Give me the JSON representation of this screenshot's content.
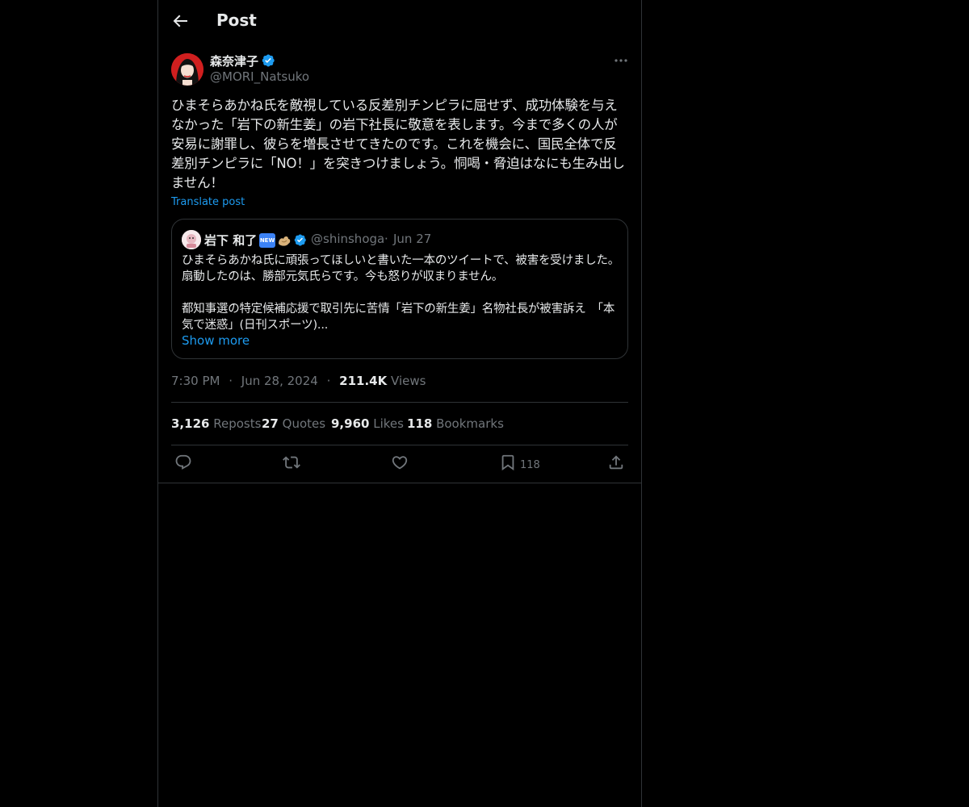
{
  "header": {
    "title": "Post"
  },
  "author": {
    "name": "森奈津子",
    "handle": "@MORI_Natsuko"
  },
  "post": {
    "text": "ひまそらあかね氏を敵視している反差別チンピラに屈せず、成功体験を与えなかった「岩下の新生姜」の岩下社長に敬意を表します。今まで多くの人が安易に謝罪し、彼らを増長させてきたのです。これを機会に、国民全体で反差別チンピラに「NO！」を突きつけましょう。恫喝・脅迫はなにも生み出しません！",
    "translate_label": "Translate post"
  },
  "quote": {
    "name": "岩下 和了",
    "badge": "NEW",
    "handle": "@shinshoga",
    "separator": "·",
    "date": "Jun 27",
    "text": "ひまそらあかね氏に頑張ってほしいと書いた一本のツイートで、被害を受けました。扇動したのは、勝部元気氏らです。今も怒りが収まりません。\n\n都知事選の特定候補応援で取引先に苦情「岩下の新生姜」名物社長が被害訴え　「本気で迷惑」(日刊スポーツ)...",
    "show_more": "Show more"
  },
  "meta": {
    "time": "7:30 PM",
    "date": "Jun 28, 2024",
    "separator": "·",
    "views_count": "211.4K",
    "views_label": "Views"
  },
  "stats": {
    "reposts_count": "3,126",
    "reposts_label": "Reposts",
    "quotes_count": "27",
    "quotes_label": "Quotes",
    "likes_count": "9,960",
    "likes_label": "Likes",
    "bookmarks_count": "118",
    "bookmarks_label": "Bookmarks"
  },
  "actions": {
    "bookmark_count": "118"
  },
  "icons": {
    "back": "arrow-left-icon",
    "verified": "verified-badge-icon",
    "more": "more-horizontal-icon",
    "reply": "reply-icon",
    "repost": "repost-icon",
    "like": "heart-icon",
    "bookmark": "bookmark-icon",
    "share": "share-icon"
  },
  "colors": {
    "background": "#000000",
    "text": "#e7e9ea",
    "secondary": "#71767b",
    "accent": "#1d9bf0",
    "border": "#2f3336"
  }
}
